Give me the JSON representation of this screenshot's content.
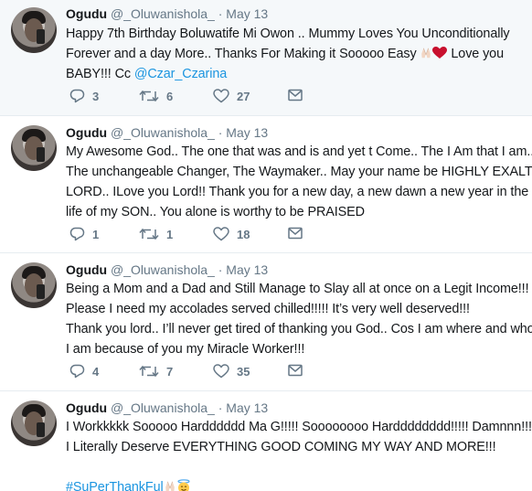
{
  "tweets": [
    {
      "name": "Ogudu",
      "handle": "@_Oluwanishola_",
      "dot": "·",
      "date": "May 13",
      "lines": [
        "Happy 7th Birthday Boluwatife Mi Owon .. Mummy Loves You Unconditionally",
        "Forever and a day More.. Thanks For Making it Sooooo Easy ",
        " Love you",
        "BABY!!! Cc "
      ],
      "mention": "@Czar_Czarina",
      "replies": "3",
      "retweets": "6",
      "likes": "27"
    },
    {
      "name": "Ogudu",
      "handle": "@_Oluwanishola_",
      "dot": "·",
      "date": "May 13",
      "lines": [
        "My Awesome God.. The one that was and is and yet t Come.. The I Am that I am..",
        "The unchangeable Changer, The Waymaker.. May your name be HIGHLY EXALTED",
        "LORD.. ILove you Lord!! Thank you for a new day, a new dawn a new year in the",
        "life of my SON.. You alone is worthy to be PRAISED"
      ],
      "replies": "1",
      "retweets": "1",
      "likes": "18"
    },
    {
      "name": "Ogudu",
      "handle": "@_Oluwanishola_",
      "dot": "·",
      "date": "May 13",
      "lines": [
        "Being a Mom and a Dad and Still Manage to Slay all at once on a Legit Income!!!",
        "Please I need my accolades served chilled!!!!! It’s very well deserved!!!",
        "Thank you lord.. I’ll never get tired of thanking you God.. Cos I am where and who",
        "I am because of you my Miracle Worker!!!"
      ],
      "replies": "4",
      "retweets": "7",
      "likes": "35"
    },
    {
      "name": "Ogudu",
      "handle": "@_Oluwanishola_",
      "dot": "·",
      "date": "May 13",
      "lines": [
        "I Workkkkk Sooooo Hardddddd Ma G!!!!! Soooooooo Hardddddddd!!!!! Damnnn!!!",
        "I Literally Deserve EVERYTHING GOOD COMING MY WAY AND MORE!!!"
      ],
      "hashtag": "#SuPerThankFul"
    }
  ],
  "icons": {
    "reply": "reply-icon",
    "retweet": "retweet-icon",
    "like": "heart-icon",
    "dm": "envelope-icon",
    "emoji_pray": "folded-hands-emoji",
    "emoji_heart": "red-heart-emoji",
    "emoji_halo": "smiling-face-with-halo-emoji"
  },
  "colors": {
    "link": "#1b95e0",
    "muted": "#657786",
    "text": "#14171a",
    "highlight_bg": "#f5f8fa",
    "divider": "#e6ecf0"
  }
}
